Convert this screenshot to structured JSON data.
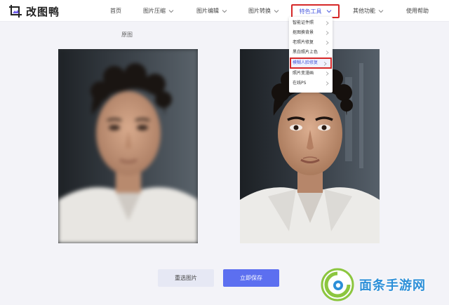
{
  "brand": {
    "name": "改图鸭",
    "logo_icon": "crop-frame-icon",
    "accent_color": "#5c6ff0",
    "highlight_color": "#d62828"
  },
  "nav": {
    "items": [
      {
        "label": "首页",
        "has_dropdown": false
      },
      {
        "label": "图片压缩",
        "has_dropdown": true
      },
      {
        "label": "图片编辑",
        "has_dropdown": true
      },
      {
        "label": "图片转换",
        "has_dropdown": true
      },
      {
        "label": "特色工具",
        "has_dropdown": true,
        "active": true
      },
      {
        "label": "其他功能",
        "has_dropdown": true
      },
      {
        "label": "使用帮助",
        "has_dropdown": false
      }
    ]
  },
  "dropdown": {
    "items": [
      {
        "label": "智能证件照"
      },
      {
        "label": "抠图换背景"
      },
      {
        "label": "老照片修复"
      },
      {
        "label": "黑白照片上色"
      },
      {
        "label": "模糊人脸修复",
        "selected": true
      },
      {
        "label": "照片变漫画"
      },
      {
        "label": "在线PS"
      }
    ]
  },
  "main": {
    "original_caption": "原图",
    "reselect_label": "重选图片",
    "save_label": "立即保存"
  },
  "watermark": {
    "text": "面条手游网"
  }
}
